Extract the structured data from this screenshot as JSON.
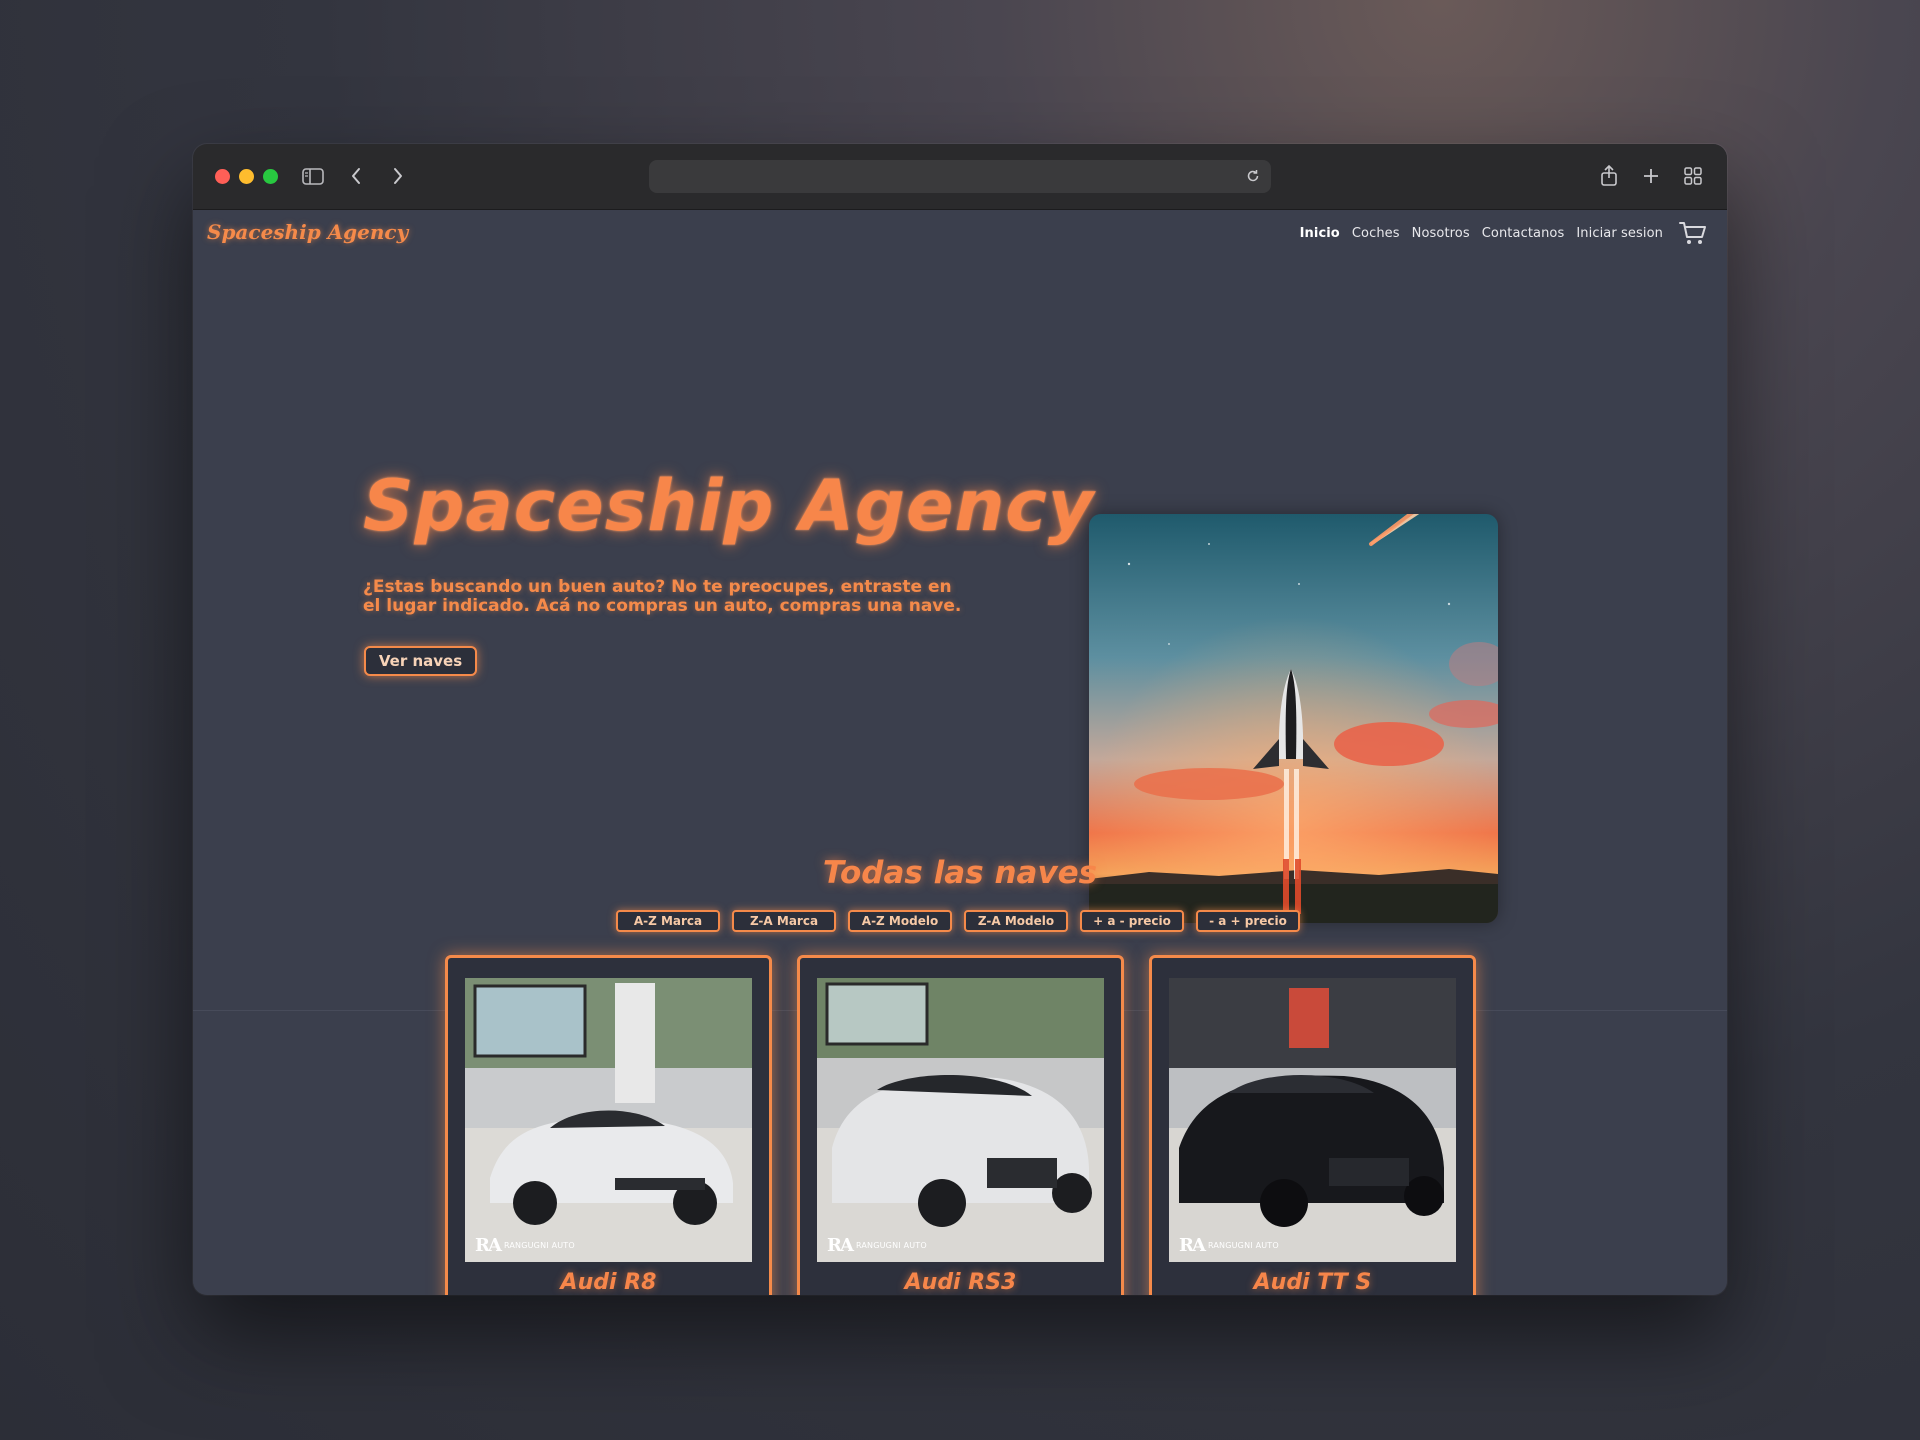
{
  "site": {
    "brand": "Spaceship Agency",
    "nav": [
      "Inicio",
      "Coches",
      "Nosotros",
      "Contactanos",
      "Iniciar sesion"
    ],
    "hero": {
      "title": "Spaceship Agency",
      "subtitle_line1": "¿Estas buscando un buen auto? No te preocupes, entraste en",
      "subtitle_line2": "el lugar indicado. Acá no compras un auto, compras una nave.",
      "button": "Ver naves"
    },
    "section": {
      "title": "Todas las naves",
      "filters": [
        "A-Z Marca",
        "Z-A Marca",
        "A-Z Modelo",
        "Z-A Modelo",
        "+ a - precio",
        "- a + precio"
      ]
    },
    "cards": [
      {
        "name": "Audi R8",
        "watermark_logo": "RA",
        "watermark_text": "RANGUGNI AUTO",
        "car_color": "#e9eaec"
      },
      {
        "name": "Audi RS3",
        "watermark_logo": "RA",
        "watermark_text": "RANGUGNI AUTO",
        "car_color": "#e4e5e7"
      },
      {
        "name": "Audi TT S",
        "watermark_logo": "RA",
        "watermark_text": "RANGUGNI AUTO",
        "car_color": "#17181c"
      }
    ]
  },
  "colors": {
    "accent": "#f58a4a",
    "page_bg": "#3b3f4d",
    "chrome_bg": "#2a2a2c"
  },
  "icons": [
    "sidebar-icon",
    "back-icon",
    "forward-icon",
    "reload-icon",
    "share-icon",
    "new-tab-icon",
    "tabs-grid-icon",
    "cart-icon"
  ]
}
